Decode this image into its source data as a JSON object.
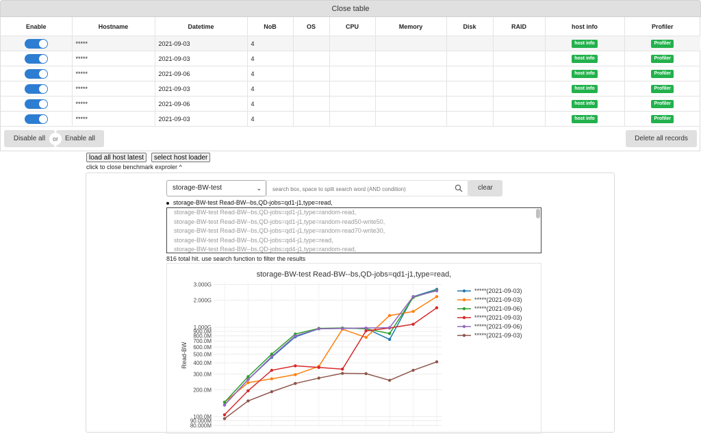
{
  "close_table_label": "Close table",
  "table": {
    "headers": [
      "Enable",
      "Hostname",
      "Datetime",
      "NoB",
      "OS",
      "CPU",
      "Memory",
      "Disk",
      "RAID",
      "host info",
      "Profiler"
    ],
    "rows": [
      {
        "enabled": true,
        "hostname": "*****",
        "datetime": "2021-09-03",
        "nob": "4",
        "host_info": "host info",
        "profiler": "Profiler"
      },
      {
        "enabled": true,
        "hostname": "*****",
        "datetime": "2021-09-03",
        "nob": "4",
        "host_info": "host info",
        "profiler": "Profiler"
      },
      {
        "enabled": true,
        "hostname": "*****",
        "datetime": "2021-09-06",
        "nob": "4",
        "host_info": "host info",
        "profiler": "Profiler"
      },
      {
        "enabled": true,
        "hostname": "*****",
        "datetime": "2021-09-03",
        "nob": "4",
        "host_info": "host info",
        "profiler": "Profiler"
      },
      {
        "enabled": true,
        "hostname": "*****",
        "datetime": "2021-09-06",
        "nob": "4",
        "host_info": "host info",
        "profiler": "Profiler"
      },
      {
        "enabled": true,
        "hostname": "*****",
        "datetime": "2021-09-03",
        "nob": "4",
        "host_info": "host info",
        "profiler": "Profiler"
      }
    ]
  },
  "actions": {
    "disable_all": "Disable all",
    "or": "or",
    "enable_all": "Enable all",
    "delete_all": "Delete all records"
  },
  "loaders": {
    "load_all": "load all host latest",
    "select_loader": "select host loader"
  },
  "explorer_close_label": "click to close benchmark exproler ^",
  "benchmark_select": {
    "value": "storage-BW-test"
  },
  "search": {
    "placeholder": "search box, space to split search word (AND condition)"
  },
  "clear_label": "clear",
  "selected_item": "storage-BW-test Read-BW--bs,QD-jobs=qd1-j1,type=read,",
  "list_items": [
    "storage-BW-test Read-BW--bs,QD-jobs=qd1-j1,type=random-read,",
    "storage-BW-test Read-BW--bs,QD-jobs=qd1-j1,type=random-read50-write50,",
    "storage-BW-test Read-BW--bs,QD-jobs=qd1-j1,type=random-read70-write30,",
    "storage-BW-test Read-BW--bs,QD-jobs=qd4-j1,type=read,",
    "storage-BW-test Read-BW--bs,QD-jobs=qd4-j1,type=random-read,"
  ],
  "hits_text": "816 total hit. use search function to filter the results",
  "chart_data": {
    "type": "line",
    "title": "storage-BW-test Read-BW--bs,QD-jobs=qd1-j1,type=read,",
    "ylabel": "Read-BW",
    "yscale": "log",
    "ylim": [
      75000000,
      3200000000
    ],
    "ytick_values": [
      80000000,
      90000000,
      100000000,
      200000000,
      300000000,
      400000000,
      500000000,
      600000000,
      700000000,
      800000000,
      900000000,
      1000000000,
      2000000000,
      3000000000
    ],
    "ytick_labels": [
      "80.000M",
      "90.000M",
      "100.0M",
      "200.0M",
      "300.0M",
      "400.0M",
      "500.0M",
      "600.0M",
      "700.0M",
      "800.0M",
      "900.0M",
      "1.000G",
      "2.000G",
      "3.000G"
    ],
    "legend_position": "top-right",
    "grid": true,
    "x": [
      1,
      2,
      3,
      4,
      5,
      6,
      7,
      8,
      9,
      10
    ],
    "series": [
      {
        "name": "*****(2021-09-03)",
        "color": "#1f77b4",
        "values": [
          135000000,
          260000000,
          460000000,
          780000000,
          960000000,
          970000000,
          970000000,
          730000000,
          2200000000,
          2650000000
        ]
      },
      {
        "name": "*****(2021-09-03)",
        "color": "#ff7f0e",
        "values": [
          145000000,
          240000000,
          265000000,
          295000000,
          365000000,
          950000000,
          770000000,
          1350000000,
          1500000000,
          2200000000
        ]
      },
      {
        "name": "*****(2021-09-06)",
        "color": "#2ca02c",
        "values": [
          145000000,
          280000000,
          500000000,
          840000000,
          970000000,
          980000000,
          960000000,
          850000000,
          2150000000,
          2600000000
        ]
      },
      {
        "name": "*****(2021-09-03)",
        "color": "#d62728",
        "values": [
          105000000,
          195000000,
          330000000,
          370000000,
          355000000,
          340000000,
          910000000,
          980000000,
          1080000000,
          1650000000
        ]
      },
      {
        "name": "*****(2021-09-06)",
        "color": "#9467bd",
        "values": [
          135000000,
          260000000,
          470000000,
          800000000,
          960000000,
          970000000,
          980000000,
          990000000,
          2200000000,
          2550000000
        ]
      },
      {
        "name": "*****(2021-09-03)",
        "color": "#8c564b",
        "values": [
          95000000,
          150000000,
          190000000,
          235000000,
          270000000,
          305000000,
          303000000,
          255000000,
          330000000,
          410000000
        ]
      }
    ]
  }
}
